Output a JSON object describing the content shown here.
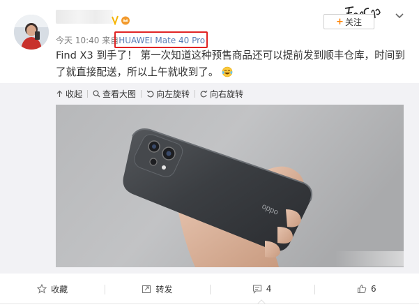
{
  "post": {
    "time": "今天 10:40",
    "source_prefix": "来自",
    "device": "HUAWEI Mate 40 Pro",
    "text": "Find X3 到手了！ 第一次知道这种预售商品还可以提前发到顺丰仓库，时间到了就直接配送，所以上午就收到了。",
    "follow_label": "关注",
    "watermark_text": "Fan Code"
  },
  "media_toolbar": {
    "collapse": "收起",
    "view_large": "查看大图",
    "rotate_left": "向左旋转",
    "rotate_right": "向右旋转"
  },
  "photo": {
    "brand_on_phone": "oppo"
  },
  "actions": {
    "favorite": "收藏",
    "repost": "转发",
    "comments": "4",
    "likes": "6"
  },
  "colors": {
    "accent": "#ff8200",
    "link": "#5a7eb5",
    "highlight_border": "#e02424"
  }
}
